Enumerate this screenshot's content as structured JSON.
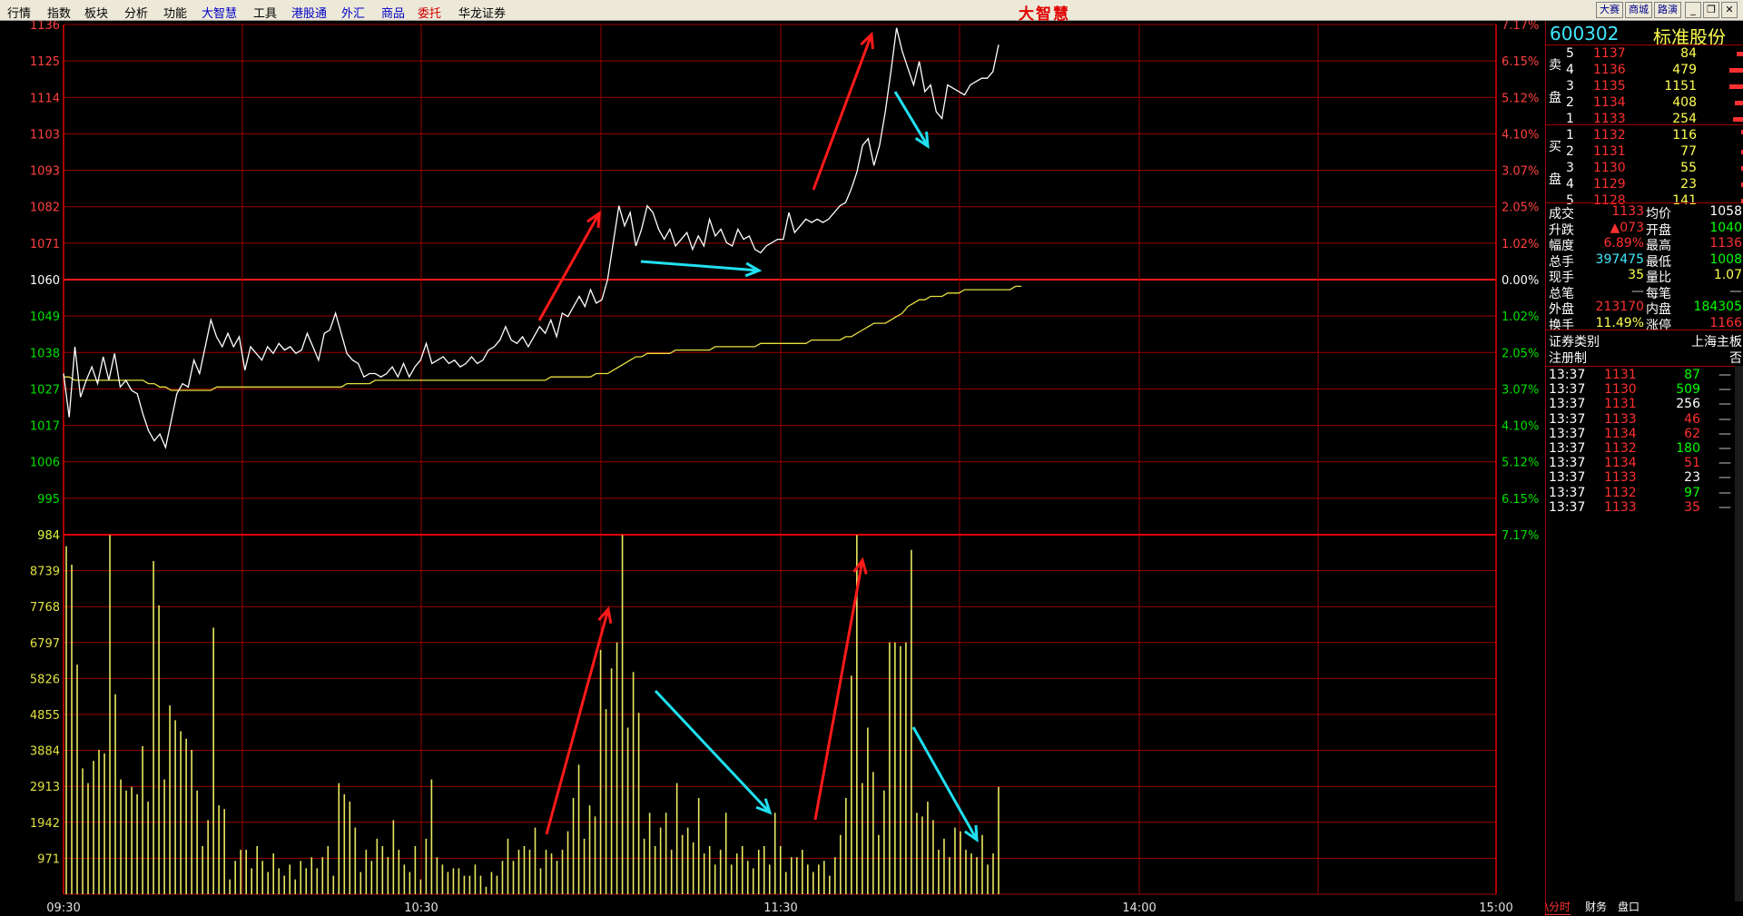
{
  "menu": {
    "items": [
      {
        "label": "行情",
        "color": "black"
      },
      {
        "label": "指数",
        "color": "black"
      },
      {
        "label": "板块",
        "color": "black"
      },
      {
        "label": "分析",
        "color": "black"
      },
      {
        "label": "功能",
        "color": "black"
      },
      {
        "label": "大智慧",
        "color": "blue"
      },
      {
        "label": "工具",
        "color": "black"
      },
      {
        "label": "港股通",
        "color": "blue"
      },
      {
        "label": "外汇",
        "color": "blue"
      },
      {
        "label": "商品",
        "color": "blue"
      },
      {
        "label": "委托",
        "color": "red"
      },
      {
        "label": "华龙证券",
        "color": "black"
      }
    ],
    "logo": "大智慧",
    "right_buttons": [
      "大赛",
      "商城",
      "路演"
    ]
  },
  "chart_data": [
    {
      "type": "line",
      "name": "price",
      "y_ticks": [
        1136,
        1125,
        1114,
        1103,
        1093,
        1082,
        1071,
        1060,
        1049,
        1038,
        1027,
        1017,
        1006,
        995,
        984
      ],
      "pct_ticks": [
        "7.17%",
        "6.15%",
        "5.12%",
        "4.10%",
        "3.07%",
        "2.05%",
        "1.02%",
        "0.00%",
        "1.02%",
        "2.05%",
        "3.07%",
        "4.10%",
        "5.12%",
        "6.15%",
        "7.17%"
      ],
      "ylim": [
        984,
        1136
      ],
      "reference": 1060,
      "x_ticks": [
        "09:30",
        "10:30",
        "11:30",
        "14:00",
        "15:00"
      ],
      "series": [
        {
          "values": [
            1032,
            1019,
            1040,
            1025,
            1030,
            1034,
            1029,
            1037,
            1030,
            1038,
            1028,
            1030,
            1027,
            1026,
            1020,
            1015,
            1012,
            1014,
            1010,
            1018,
            1026,
            1029,
            1028,
            1036,
            1032,
            1040,
            1048,
            1043,
            1040,
            1044,
            1040,
            1043,
            1033,
            1040,
            1038,
            1036,
            1040,
            1038,
            1041,
            1039,
            1040,
            1038,
            1039,
            1044,
            1040,
            1036,
            1044,
            1045,
            1050,
            1044,
            1038,
            1036,
            1035,
            1031,
            1032,
            1032,
            1031,
            1032,
            1034,
            1031,
            1035,
            1031,
            1034,
            1036,
            1041,
            1035,
            1036,
            1037,
            1035,
            1036,
            1034,
            1035,
            1037,
            1035,
            1036,
            1039,
            1040,
            1042,
            1046,
            1042,
            1041,
            1043,
            1040,
            1043,
            1046,
            1044,
            1048,
            1043,
            1050,
            1049,
            1052,
            1055,
            1052,
            1057,
            1053,
            1054,
            1060,
            1071,
            1082,
            1076,
            1080,
            1070,
            1075,
            1082,
            1080,
            1075,
            1072,
            1075,
            1070,
            1072,
            1074,
            1069,
            1073,
            1070,
            1078,
            1073,
            1075,
            1071,
            1070,
            1075,
            1072,
            1073,
            1069,
            1068,
            1070,
            1071,
            1072,
            1072,
            1080,
            1074,
            1076,
            1078,
            1077,
            1078,
            1077,
            1078,
            1080,
            1082,
            1083,
            1087,
            1092,
            1100,
            1102,
            1094,
            1100,
            1110,
            1122,
            1135,
            1128,
            1123,
            1118,
            1125,
            1116,
            1118,
            1110,
            1108,
            1118,
            1117,
            1116,
            1115,
            1118,
            1119,
            1120,
            1120,
            1122,
            1130
          ]
        },
        {
          "values": [
            1031,
            1031,
            1030,
            1030,
            1030,
            1030,
            1030,
            1030,
            1030,
            1030,
            1030,
            1030,
            1030,
            1030,
            1030,
            1029,
            1029,
            1028,
            1028,
            1027,
            1027,
            1027,
            1027,
            1027,
            1027,
            1027,
            1027,
            1028,
            1028,
            1028,
            1028,
            1028,
            1028,
            1028,
            1028,
            1028,
            1028,
            1028,
            1028,
            1028,
            1028,
            1028,
            1028,
            1028,
            1028,
            1028,
            1028,
            1028,
            1028,
            1028,
            1029,
            1029,
            1029,
            1029,
            1029,
            1030,
            1030,
            1030,
            1030,
            1030,
            1030,
            1030,
            1030,
            1030,
            1030,
            1030,
            1030,
            1030,
            1030,
            1030,
            1030,
            1030,
            1030,
            1030,
            1030,
            1030,
            1030,
            1030,
            1030,
            1030,
            1030,
            1030,
            1030,
            1030,
            1030,
            1030,
            1031,
            1031,
            1031,
            1031,
            1031,
            1031,
            1031,
            1031,
            1032,
            1032,
            1032,
            1033,
            1034,
            1035,
            1036,
            1037,
            1037,
            1038,
            1038,
            1038,
            1038,
            1038,
            1039,
            1039,
            1039,
            1039,
            1039,
            1039,
            1039,
            1040,
            1040,
            1040,
            1040,
            1040,
            1040,
            1040,
            1040,
            1041,
            1041,
            1041,
            1041,
            1041,
            1041,
            1041,
            1041,
            1041,
            1042,
            1042,
            1042,
            1042,
            1042,
            1042,
            1043,
            1043,
            1044,
            1045,
            1046,
            1047,
            1047,
            1047,
            1048,
            1049,
            1050,
            1052,
            1053,
            1054,
            1054,
            1055,
            1055,
            1055,
            1056,
            1056,
            1056,
            1057,
            1057,
            1057,
            1057,
            1057,
            1057,
            1057,
            1057,
            1057,
            1058,
            1058
          ]
        }
      ]
    },
    {
      "type": "bar",
      "name": "volume",
      "y_ticks": [
        "984",
        "8739",
        "7768",
        "6797",
        "5826",
        "4855",
        "3884",
        "2913",
        "1942",
        "971"
      ],
      "ylim": [
        0,
        9710
      ],
      "values": [
        9400,
        8900,
        6200,
        3400,
        3000,
        3600,
        3900,
        3800,
        9700,
        5400,
        3100,
        2800,
        2900,
        2700,
        4000,
        2500,
        9000,
        7800,
        3100,
        5100,
        4700,
        4400,
        4200,
        3900,
        2800,
        1300,
        2000,
        7200,
        2400,
        2300,
        400,
        900,
        1200,
        1200,
        700,
        1300,
        900,
        600,
        1100,
        700,
        500,
        800,
        400,
        900,
        700,
        1000,
        700,
        1000,
        1300,
        500,
        3000,
        2700,
        2500,
        1800,
        600,
        1200,
        900,
        1500,
        1300,
        1000,
        2000,
        1200,
        800,
        600,
        1300,
        400,
        1500,
        3100,
        1000,
        800,
        600,
        700,
        700,
        500,
        500,
        800,
        500,
        200,
        600,
        500,
        900,
        1500,
        900,
        1200,
        1300,
        1200,
        1800,
        700,
        1200,
        1100,
        900,
        1200,
        1700,
        2600,
        3500,
        1500,
        2400,
        2100,
        6600,
        5000,
        6100,
        6800,
        9700,
        4500,
        6000,
        4900,
        1500,
        2200,
        1300,
        1800,
        2200,
        1200,
        3000,
        1600,
        1800,
        1400,
        2600,
        1100,
        1300,
        800,
        1200,
        2200,
        800,
        1100,
        1300,
        900,
        700,
        1200,
        1300,
        800,
        2200,
        1300,
        600,
        1000,
        1000,
        1200,
        800,
        600,
        800,
        900,
        500,
        1000,
        1600,
        2600,
        5900,
        9700,
        3000,
        4500,
        3300,
        1600,
        2800,
        6800,
        6800,
        6700,
        6800,
        9300,
        2200,
        2100,
        2500,
        2000,
        1200,
        1500,
        1000,
        1800,
        1700,
        1200,
        1100,
        1000,
        1600,
        800,
        1100,
        2900
      ]
    }
  ],
  "annotations": {
    "price_up": 2,
    "price_down": 2,
    "vol_up": 2,
    "vol_down": 2
  },
  "panel": {
    "code": "600302",
    "name": "标准股份",
    "sell_label": [
      "卖",
      "盘"
    ],
    "buy_label": [
      "买",
      "盘"
    ],
    "asks": [
      {
        "level": "5",
        "price": "1137",
        "vol": "84"
      },
      {
        "level": "4",
        "price": "1136",
        "vol": "479"
      },
      {
        "level": "3",
        "price": "1135",
        "vol": "1151"
      },
      {
        "level": "2",
        "price": "1134",
        "vol": "408"
      },
      {
        "level": "1",
        "price": "1133",
        "vol": "254"
      }
    ],
    "bids": [
      {
        "level": "1",
        "price": "1132",
        "vol": "116"
      },
      {
        "level": "2",
        "price": "1131",
        "vol": "77"
      },
      {
        "level": "3",
        "price": "1130",
        "vol": "55"
      },
      {
        "level": "4",
        "price": "1129",
        "vol": "23"
      },
      {
        "level": "5",
        "price": "1128",
        "vol": "141"
      }
    ],
    "quote": [
      {
        "l1": "成交",
        "v1": "1133",
        "c1": "r",
        "l2": "均价",
        "v2": "1058",
        "c2": "w"
      },
      {
        "l1": "升跌",
        "v1": "▲073",
        "c1": "r",
        "l2": "开盘",
        "v2": "1040",
        "c2": "g"
      },
      {
        "l1": "幅度",
        "v1": "6.89%",
        "c1": "r",
        "l2": "最高",
        "v2": "1136",
        "c2": "r"
      },
      {
        "l1": "总手",
        "v1": "397475",
        "c1": "c",
        "l2": "最低",
        "v2": "1008",
        "c2": "g"
      },
      {
        "l1": "现手",
        "v1": "35",
        "c1": "y",
        "l2": "量比",
        "v2": "1.07",
        "c2": "y"
      },
      {
        "l1": "总笔",
        "v1": "—",
        "c1": "gr",
        "l2": "每笔",
        "v2": "—",
        "c2": "gr"
      },
      {
        "l1": "外盘",
        "v1": "213170",
        "c1": "r",
        "l2": "内盘",
        "v2": "184305",
        "c2": "g"
      },
      {
        "l1": "换手",
        "v1": "11.49%",
        "c1": "y",
        "l2": "涨停",
        "v2": "1166",
        "c2": "r"
      }
    ],
    "info": [
      {
        "label": "证券类别",
        "value": "上海主板"
      },
      {
        "label": "注册制",
        "value": "否"
      }
    ],
    "ticks": [
      {
        "time": "13:37",
        "price": "1131",
        "vol": "87",
        "vc": "g"
      },
      {
        "time": "13:37",
        "price": "1130",
        "vol": "509",
        "vc": "g"
      },
      {
        "time": "13:37",
        "price": "1131",
        "vol": "256",
        "vc": "w"
      },
      {
        "time": "13:37",
        "price": "1133",
        "vol": "46",
        "vc": "r"
      },
      {
        "time": "13:37",
        "price": "1134",
        "vol": "62",
        "vc": "r"
      },
      {
        "time": "13:37",
        "price": "1132",
        "vol": "180",
        "vc": "g"
      },
      {
        "time": "13:37",
        "price": "1134",
        "vol": "51",
        "vc": "r"
      },
      {
        "time": "13:37",
        "price": "1133",
        "vol": "23",
        "vc": "w"
      },
      {
        "time": "13:37",
        "price": "1132",
        "vol": "97",
        "vc": "g"
      },
      {
        "time": "13:37",
        "price": "1133",
        "vol": "35",
        "vc": "r"
      }
    ],
    "tick_flags": [
      "—",
      "—",
      "—",
      "—",
      "—",
      "—",
      "—",
      "—",
      "—",
      "—"
    ],
    "bottom_tabs": [
      "\\分时",
      "财务",
      "盘口"
    ]
  }
}
